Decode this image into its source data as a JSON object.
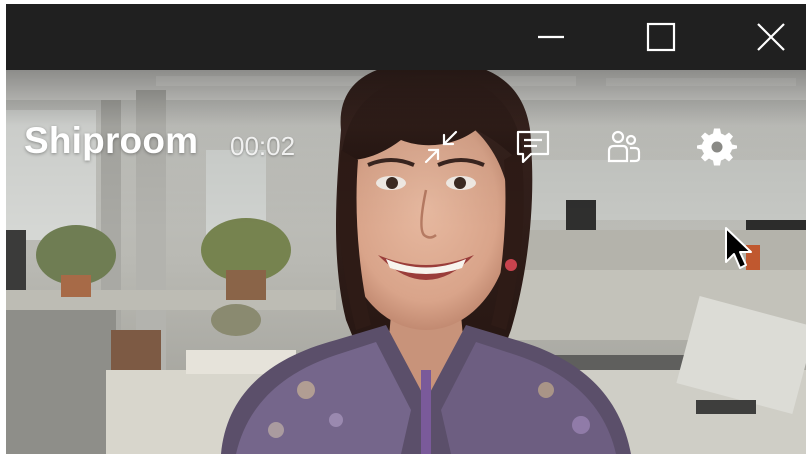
{
  "window_controls": {
    "minimize_icon": "minimize-icon",
    "maximize_icon": "maximize-icon",
    "close_icon": "close-icon"
  },
  "call": {
    "title": "Shiproom",
    "timer": "00:02"
  },
  "controls": [
    {
      "name": "shrink",
      "icon": "shrink-arrows-icon"
    },
    {
      "name": "chat",
      "icon": "chat-icon"
    },
    {
      "name": "people",
      "icon": "people-icon"
    },
    {
      "name": "settings",
      "icon": "gear-icon"
    }
  ],
  "colors": {
    "titlebar": "#202020",
    "overlay_text": "#ffffff",
    "sweater_accent": "#7a5a9a"
  }
}
